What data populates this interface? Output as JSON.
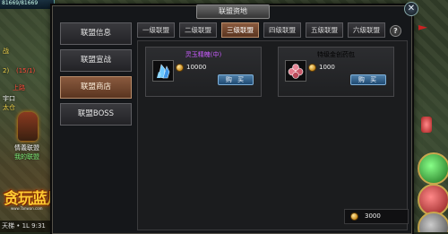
{
  "hud": {
    "hp_text": "81669/81669",
    "side_labels": [
      {
        "text": "战",
        "tone": "yellow"
      },
      {
        "text": "2)",
        "tone": "yellow"
      },
      {
        "text": "(15/1)",
        "tone": "red"
      },
      {
        "text": "上路",
        "tone": "red"
      },
      {
        "text": "宇口",
        "tone": "white"
      },
      {
        "text": "太仓",
        "tone": "yellow"
      },
      {
        "text": "情義联盟",
        "tone": "white"
      },
      {
        "text": "我的联盟",
        "tone": "green"
      }
    ],
    "bottom_status": "天梯 • 1L 9:31",
    "logo_title": "贪玩蓝月",
    "logo_url": "www.Tanwan.com"
  },
  "dialog": {
    "title": "联盟资地",
    "close_label": "✕",
    "help_label": "?",
    "nav": [
      {
        "label": "联盟信息",
        "active": false
      },
      {
        "label": "联盟宣战",
        "active": false
      },
      {
        "label": "联盟商店",
        "active": true
      },
      {
        "label": "联盟BOSS",
        "active": false
      }
    ],
    "tabs": [
      {
        "label": "一级联盟",
        "active": false
      },
      {
        "label": "二级联盟",
        "active": false
      },
      {
        "label": "三级联盟",
        "active": true
      },
      {
        "label": "四级联盟",
        "active": false
      },
      {
        "label": "五级联盟",
        "active": false
      },
      {
        "label": "六级联盟",
        "active": false
      }
    ],
    "items": [
      {
        "name": "灵玉精魄(中)",
        "name_color": "#c95cff",
        "icon": "blue-crystal-icon",
        "price": "10000",
        "buy_label": "购 买"
      },
      {
        "name": "特级金创药包",
        "name_color": "#e8e8e8",
        "icon": "potion-pack-icon",
        "price": "1000",
        "buy_label": "购 买"
      }
    ],
    "balance": "3000"
  }
}
